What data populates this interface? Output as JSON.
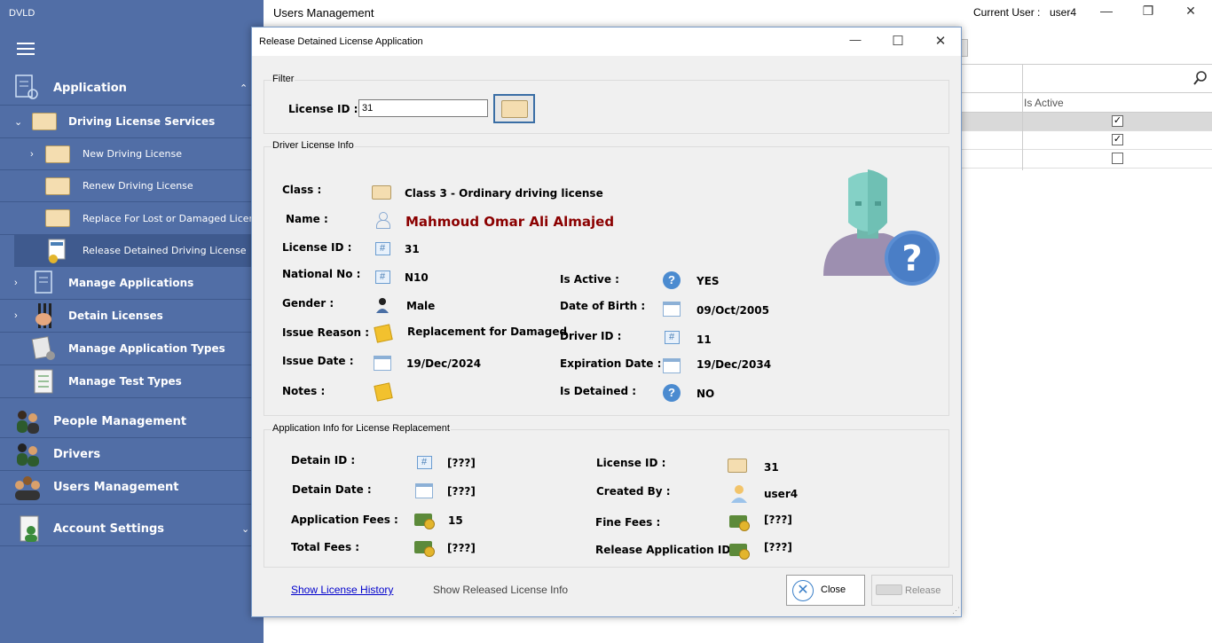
{
  "sidebar": {
    "app_title": "DVLD",
    "items": [
      {
        "label": "Application"
      },
      {
        "label": "Driving License Services"
      },
      {
        "label": "New Driving License"
      },
      {
        "label": "Renew Driving License"
      },
      {
        "label": "Replace For Lost or Damaged License"
      },
      {
        "label": "Release Detained Driving License"
      },
      {
        "label": "Manage Applications"
      },
      {
        "label": "Detain Licenses"
      },
      {
        "label": "Manage Application Types"
      },
      {
        "label": "Manage Test Types"
      },
      {
        "label": "People Management"
      },
      {
        "label": "Drivers"
      },
      {
        "label": "Users Management"
      },
      {
        "label": "Account Settings"
      }
    ]
  },
  "main": {
    "title": "Users Management",
    "current_user_label": "Current User :",
    "current_user": "user4",
    "grid": {
      "col_is_active": "Is Active"
    }
  },
  "dialog": {
    "title": "Release Detained License Application",
    "filter": {
      "caption": "Filter",
      "license_id_label": "License ID :",
      "license_id_value": "31"
    },
    "driver_info": {
      "caption": "Driver License Info",
      "class_label": "Class :",
      "class_value": "Class 3 - Ordinary driving license",
      "name_label": "Name :",
      "name_value": "Mahmoud Omar Ali Almajed",
      "license_id_label": "License ID :",
      "license_id_value": "31",
      "national_no_label": "National No :",
      "national_no_value": "N10",
      "gender_label": "Gender :",
      "gender_value": "Male",
      "issue_reason_label": "Issue Reason :",
      "issue_reason_value": "Replacement for Damaged",
      "issue_date_label": "Issue Date :",
      "issue_date_value": "19/Dec/2024",
      "notes_label": "Notes :",
      "is_active_label": "Is Active :",
      "is_active_value": "YES",
      "dob_label": "Date of Birth :",
      "dob_value": "09/Oct/2005",
      "driver_id_label": "Driver ID :",
      "driver_id_value": "11",
      "expiration_label": "Expiration Date :",
      "expiration_value": "19/Dec/2034",
      "is_detained_label": "Is Detained :",
      "is_detained_value": "NO"
    },
    "app_info": {
      "caption": "Application Info for License Replacement",
      "detain_id_label": "Detain ID :",
      "detain_id_value": "[???]",
      "detain_date_label": "Detain Date :",
      "detain_date_value": "[???]",
      "app_fees_label": "Application Fees :",
      "app_fees_value": "15",
      "total_fees_label": "Total Fees :",
      "total_fees_value": "[???]",
      "license_id_label": "License ID :",
      "license_id_value": "31",
      "created_by_label": "Created By :",
      "created_by_value": "user4",
      "fine_fees_label": "Fine Fees :",
      "fine_fees_value": "[???]",
      "release_app_id_label": "Release Application ID:",
      "release_app_id_value": "[???]"
    },
    "links": {
      "history": "Show License History",
      "released_info": "Show Released License Info"
    },
    "buttons": {
      "close": "Close",
      "release": "Release"
    }
  },
  "colors": {
    "sidebar_bg": "#516ea6",
    "name_text": "#8b0000",
    "link": "#0000cc"
  }
}
